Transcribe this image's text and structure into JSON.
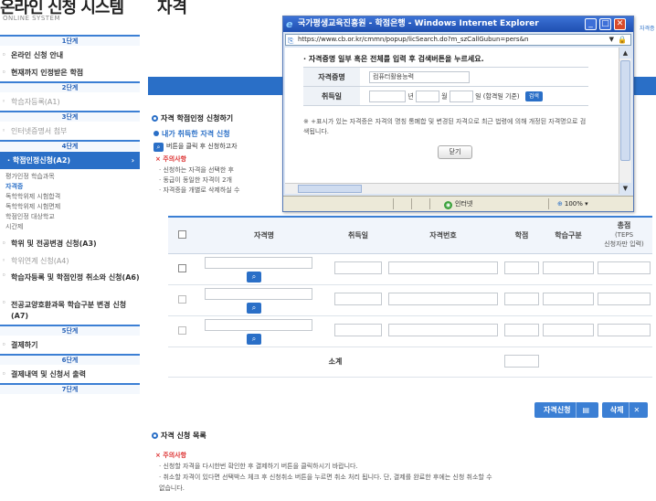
{
  "sidebar": {
    "title": "온라인 신청 시스템",
    "subtitle": "ONLINE SYSTEM",
    "steps": {
      "s1": "1단계",
      "s2": "2단계",
      "s3": "3단계",
      "s4": "4단계",
      "s5": "5단계",
      "s6": "6단계",
      "s7": "7단계"
    },
    "items": {
      "guide": "온라인 신청 안내",
      "current_credits": "현재까지 인정받은 학점",
      "learner_reg": "학습자등록(A1)",
      "internet_cert": "인터넷증명서 첨부",
      "credit_app": "학점인정신청(A2)",
      "major_change": "학위 및 전공변경 신청(A3)",
      "degree_link": "학위연계 신청(A4)",
      "learner_cancel": "학습자등록 및 학점인정 취소와 신청(A6)",
      "liberal_change": "전공교양호환과목 학습구분 변경 신청(A7)",
      "payment": "결제하기",
      "history": "결제내역 및 신청서 출력"
    },
    "sub_items": [
      "평가인정 학습과목",
      "자격증",
      "독학학위제 시험합격",
      "독학학위제 시험면제",
      "학점인정 대상학교",
      "시간제"
    ]
  },
  "main": {
    "page_title": "자격",
    "right_cut_text": "자격증",
    "section1_title": "자격 학점인정 신청하기",
    "sub_title": "내가 취득한 자격 신청",
    "guide_text": "버튼을 클릭 후 신청하고자",
    "caution_title": "× 주의사항",
    "caution_lines": [
      "· 신청하는 자격을 선택한 후",
      "· 동급이 동일한 자격이 2개",
      "· 자격증을 개별로 삭제하실 수"
    ],
    "table_headers": {
      "name": "자격명",
      "date": "취득일",
      "number": "자격번호",
      "credit": "학점",
      "type": "학습구분",
      "score_main": "총점",
      "score_sub1": "(TEPS",
      "score_sub2": "신청자만 입력)"
    },
    "sum_label": "소계",
    "apply_button": "자격신청",
    "delete_button": "삭제",
    "section2_title": "자격 신청 목록",
    "caution2_title": "× 주의사항",
    "caution2_lines": [
      "· 신청할 자격을 다시한번 확인한 후 결제하기 버튼을 클릭하시기 바랍니다.",
      "· 취소할 자격이 있다면 선택박스 체크 후 신청취소 버튼을 누르면 취소 처리 됩니다. 단, 결제를 완료한 후에는 신청 취소할 수",
      "  없습니다."
    ]
  },
  "popup": {
    "window_title": "국가평생교육진흥원 - 학점은행 - Windows Internet Explorer",
    "url": "https://www.cb.or.kr/cmmn/popup/licSearch.do?m_szCallGubun=pers&n",
    "instruction": "· 자격증명 일부 혹은 전체를 입력 후 검색버튼을 누르세요.",
    "label_name": "자격증명",
    "name_value": "컴퓨터활용능력",
    "label_date": "취득일",
    "date_year": "년",
    "date_month": "월",
    "date_day": "일 (합격일 기준)",
    "search_btn": "검색",
    "note": "※ +표시가 있는 자격증은 자격의 명칭 통폐합 및 변경된 자격으로 최근 법령에 의해 개정된 자격명으로 검색됩니다.",
    "close_btn": "닫기",
    "status_zone": "인터넷",
    "zoom": "100%"
  }
}
